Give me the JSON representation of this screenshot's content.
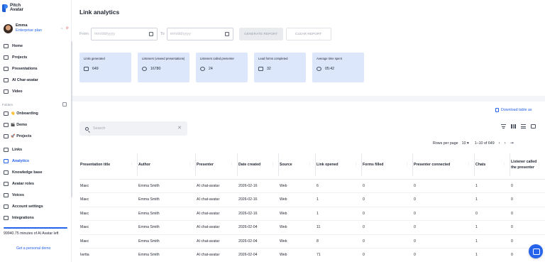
{
  "app": {
    "logo_line1": "Pitch",
    "logo_line2": "Avatar"
  },
  "user": {
    "name": "Emma",
    "plan": "Enterprise plan"
  },
  "sidebar": {
    "items": [
      {
        "label": "Home",
        "name": "sidebar-item-home",
        "icon": "home-icon"
      },
      {
        "label": "Projects",
        "name": "sidebar-item-projects",
        "icon": "folder-icon"
      },
      {
        "label": "Presentations",
        "name": "sidebar-item-presentations",
        "icon": "presentation-icon"
      },
      {
        "label": "AI Char-avatar",
        "name": "sidebar-item-ai-char-avatar",
        "icon": "chat-avatar-icon"
      },
      {
        "label": "Video",
        "name": "sidebar-item-video",
        "icon": "video-icon"
      }
    ],
    "folders_label": "Folders",
    "folders": [
      {
        "emoji": "👋",
        "label": "Onboarding"
      },
      {
        "emoji": "🎬",
        "label": "Demo"
      },
      {
        "emoji": "🚀",
        "label": "Projects"
      }
    ],
    "bottom_items": [
      {
        "label": "Links",
        "name": "sidebar-item-links",
        "active": false
      },
      {
        "label": "Analytics",
        "name": "sidebar-item-analytics",
        "active": true
      },
      {
        "label": "Knowledge base",
        "name": "sidebar-item-knowledge-base",
        "active": false
      },
      {
        "label": "Avatar roles",
        "name": "sidebar-item-avatar-roles",
        "active": false
      },
      {
        "label": "Voices",
        "name": "sidebar-item-voices",
        "active": false
      },
      {
        "label": "Account settings",
        "name": "sidebar-item-account-settings",
        "active": false
      },
      {
        "label": "Integrations",
        "name": "sidebar-item-integrations",
        "active": false
      }
    ],
    "minutes_text": "99940.75 minutes of AI Avatar left",
    "demo_link": "Get a personal demo"
  },
  "page": {
    "title": "Link analytics"
  },
  "filters": {
    "from_label": "From",
    "to_label": "To",
    "from_placeholder": "mm/dd/yyyy",
    "to_placeholder": "mm/dd/yyyy",
    "generate_label": "GENERATE REPORT",
    "clear_label": "CLEAR REPORT"
  },
  "stats": [
    {
      "label": "Links generated",
      "value": "649",
      "icon": "links-icon"
    },
    {
      "label": "Listeners (viewed presentations)",
      "value": "16780",
      "icon": "listeners-icon"
    },
    {
      "label": "Listeners called presenter",
      "value": "24",
      "icon": "called-presenter-icon"
    },
    {
      "label": "Lead forms completed",
      "value": "32",
      "icon": "form-icon"
    },
    {
      "label": "Average time spent",
      "value": "05:42",
      "icon": "clock-icon"
    }
  ],
  "download_label": "Download table as",
  "search": {
    "placeholder": "Search"
  },
  "pager": {
    "rows_per_page_label": "Rows per page",
    "rows_per_page": "10",
    "range": "1–10 of 649"
  },
  "table": {
    "columns": [
      "Presentation title",
      "Author",
      "Presenter",
      "Date created",
      "Source",
      "Link opened",
      "Forms filled",
      "Presenter connected",
      "Chats",
      "Listener called the presenter"
    ],
    "rows": [
      [
        "Макс",
        "Emma Smith",
        "AI chat-avatar",
        "2026-02-16",
        "Web",
        "6",
        "0",
        "0",
        "1",
        "0"
      ],
      [
        "Макс",
        "Emma Smith",
        "AI chat-avatar",
        "2026-02-16",
        "Web",
        "1",
        "0",
        "0",
        "1",
        "0"
      ],
      [
        "Макс",
        "Emma Smith",
        "AI chat-avatar",
        "2026-02-16",
        "Web",
        "1",
        "0",
        "0",
        "0",
        "0"
      ],
      [
        "Макс",
        "Emma Smith",
        "AI chat-avatar",
        "2026-02-04",
        "Web",
        "11",
        "0",
        "0",
        "1",
        "0"
      ],
      [
        "Макс",
        "Emma Smith",
        "AI chat-avatar",
        "2026-02-04",
        "Web",
        "8",
        "0",
        "0",
        "1",
        "0"
      ],
      [
        "Iwrtta",
        "Emma Smith",
        "AI chat-avatar",
        "2026-02-04",
        "Web",
        "71",
        "0",
        "0",
        "1",
        "0"
      ]
    ]
  },
  "colors": {
    "accent": "#2563eb",
    "stat_card": "#dde7fb"
  }
}
